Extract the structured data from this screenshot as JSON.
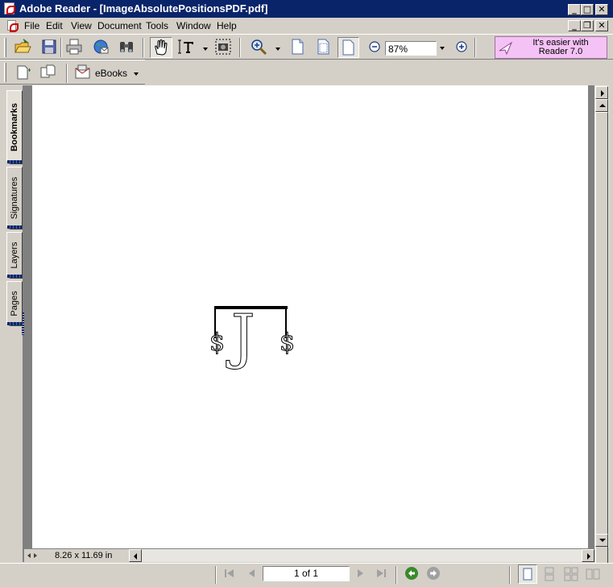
{
  "window": {
    "title": "Adobe Reader - [ImageAbsolutePositionsPDF.pdf]",
    "controls": [
      "_",
      "□",
      "✕"
    ],
    "doc_controls": [
      "_",
      "❐",
      "✕"
    ]
  },
  "menu": {
    "items": [
      "File",
      "Edit",
      "View",
      "Document",
      "Tools",
      "Window",
      "Help"
    ]
  },
  "toolbar": {
    "zoom_value": "87%",
    "promo_line1": "It's easier with",
    "promo_line2": "Reader 7.0",
    "ebooks_label": "eBooks"
  },
  "side_tabs": [
    "Bookmarks",
    "Signatures",
    "Layers",
    "Pages"
  ],
  "document": {
    "page_size": "8.26 x 11.69 in",
    "image_glyphs": {
      "left": "$",
      "center": "J",
      "right": "$"
    }
  },
  "status": {
    "page_indicator": "1 of 1"
  },
  "colors": {
    "titlebar": "#0a246a",
    "promo_bg": "#f4c2f4",
    "nav_green": "#3a8a2a"
  }
}
